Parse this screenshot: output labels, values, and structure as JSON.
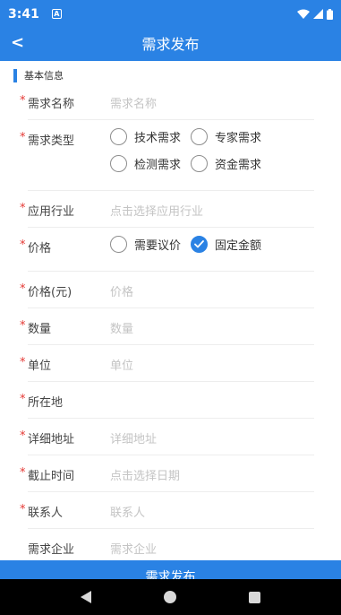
{
  "status_bar": {
    "time": "3:41",
    "notification_icon": "A"
  },
  "header": {
    "back_label": "<",
    "title": "需求发布"
  },
  "section": {
    "title": "基本信息"
  },
  "form": {
    "required_mark": "*",
    "name": {
      "label": "需求名称",
      "placeholder": "需求名称"
    },
    "type": {
      "label": "需求类型",
      "options": [
        "技术需求",
        "专家需求",
        "检测需求",
        "资金需求"
      ]
    },
    "industry": {
      "label": "应用行业",
      "placeholder": "点击选择应用行业"
    },
    "price": {
      "label": "价格",
      "options": [
        "需要议价",
        "固定金额"
      ],
      "selected": "固定金额"
    },
    "price_amount": {
      "label": "价格(元)",
      "placeholder": "价格"
    },
    "quantity": {
      "label": "数量",
      "placeholder": "数量"
    },
    "unit": {
      "label": "单位",
      "placeholder": "单位"
    },
    "location": {
      "label": "所在地",
      "value": ""
    },
    "address": {
      "label": "详细地址",
      "placeholder": "详细地址"
    },
    "deadline": {
      "label": "截止时间",
      "placeholder": "点击选择日期"
    },
    "contact": {
      "label": "联系人",
      "placeholder": "联系人"
    },
    "company": {
      "label": "需求企业",
      "placeholder": "需求企业"
    }
  },
  "submit": {
    "label": "需求发布"
  },
  "colors": {
    "primary": "#2a82e4",
    "required": "#e53935",
    "placeholder": "#c4c4c4"
  }
}
